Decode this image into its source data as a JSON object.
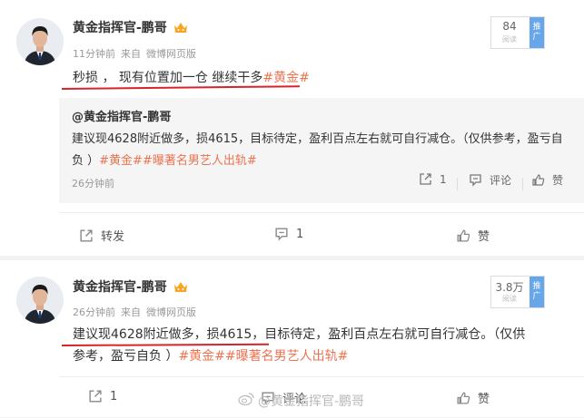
{
  "post1": {
    "author": "黄金指挥官-鹏哥",
    "time": "11分钟前",
    "source_prefix": "来自",
    "source": "微博网页版",
    "views": "84",
    "views_label": "阅读",
    "promote": "推广",
    "text": "秒损 ， 现有位置加一仓 继续干多",
    "tag": "#黄金#",
    "repost": {
      "author": "@黄金指挥官-鹏哥",
      "text": "建议现4628附近做多，损4615，目标待定，盈利百点左右就可自行减仓。（仅供参考，盈亏自负 ）",
      "tags": "#黄金##曝著名男艺人出轨#",
      "time": "26分钟前",
      "repost_count": "1",
      "comment_label": "评论",
      "like_label": "赞"
    },
    "actions": {
      "repost": "转发",
      "comment": "1",
      "like": "赞"
    }
  },
  "post2": {
    "author": "黄金指挥官-鹏哥",
    "time": "26分钟前",
    "source_prefix": "来自",
    "source": "微博网页版",
    "views": "3.8万",
    "views_label": "阅读",
    "promote": "推广",
    "text_line1": "建议现4628附近做多，损4615，目标待定，盈利百点左右就可自行减仓。（仅供",
    "text_line2": "参考，盈亏自负 ）",
    "tags": "#黄金##曝著名男艺人出轨#",
    "actions": {
      "repost": "1",
      "comment": "评论",
      "like": "赞"
    }
  },
  "watermark": "@黄金指挥官-鹏哥",
  "colors": {
    "tag": "#eb7350",
    "underline": "#d9232b",
    "promote": "#67a6e8"
  }
}
